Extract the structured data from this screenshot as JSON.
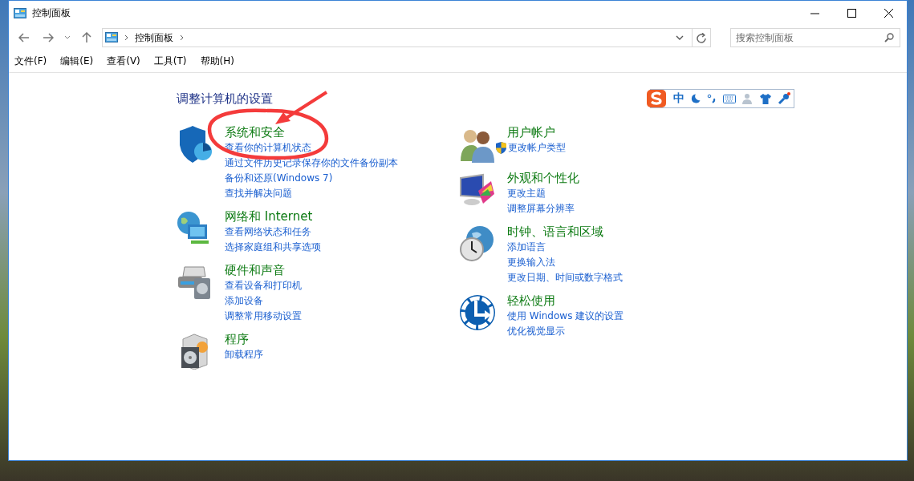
{
  "window": {
    "title": "控制面板"
  },
  "address_bar": {
    "crumbs": [
      "控制面板"
    ]
  },
  "search": {
    "placeholder": "搜索控制面板"
  },
  "menu": [
    "文件(F)",
    "编辑(E)",
    "查看(V)",
    "工具(T)",
    "帮助(H)"
  ],
  "heading": "调整计算机的设置",
  "ime_bar": {
    "mode": "中"
  },
  "columns": [
    [
      {
        "title": "系统和安全",
        "links": [
          {
            "text": "查看你的计算机状态",
            "kind": "plain"
          },
          {
            "text": "通过文件历史记录保存你的文件备份副本",
            "kind": "plain"
          },
          {
            "text": "备份和还原(Windows 7)",
            "kind": "plain"
          },
          {
            "text": "查找并解决问题",
            "kind": "plain"
          }
        ]
      },
      {
        "title": "网络和 Internet",
        "links": [
          {
            "text": "查看网络状态和任务",
            "kind": "plain"
          },
          {
            "text": "选择家庭组和共享选项",
            "kind": "plain"
          }
        ]
      },
      {
        "title": "硬件和声音",
        "links": [
          {
            "text": "查看设备和打印机",
            "kind": "plain"
          },
          {
            "text": "添加设备",
            "kind": "plain"
          },
          {
            "text": "调整常用移动设置",
            "kind": "plain"
          }
        ]
      },
      {
        "title": "程序",
        "links": [
          {
            "text": "卸载程序",
            "kind": "plain"
          }
        ]
      }
    ],
    [
      {
        "title": "用户帐户",
        "links": [
          {
            "text": "更改帐户类型",
            "kind": "admin"
          }
        ]
      },
      {
        "title": "外观和个性化",
        "links": [
          {
            "text": "更改主题",
            "kind": "plain"
          },
          {
            "text": "调整屏幕分辨率",
            "kind": "plain"
          }
        ]
      },
      {
        "title": "时钟、语言和区域",
        "links": [
          {
            "text": "添加语言",
            "kind": "plain"
          },
          {
            "text": "更换输入法",
            "kind": "plain"
          },
          {
            "text": "更改日期、时间或数字格式",
            "kind": "plain"
          }
        ]
      },
      {
        "title": "轻松使用",
        "links": [
          {
            "text": "使用 Windows 建议的设置",
            "kind": "plain"
          },
          {
            "text": "优化视觉显示",
            "kind": "plain"
          }
        ]
      }
    ]
  ]
}
